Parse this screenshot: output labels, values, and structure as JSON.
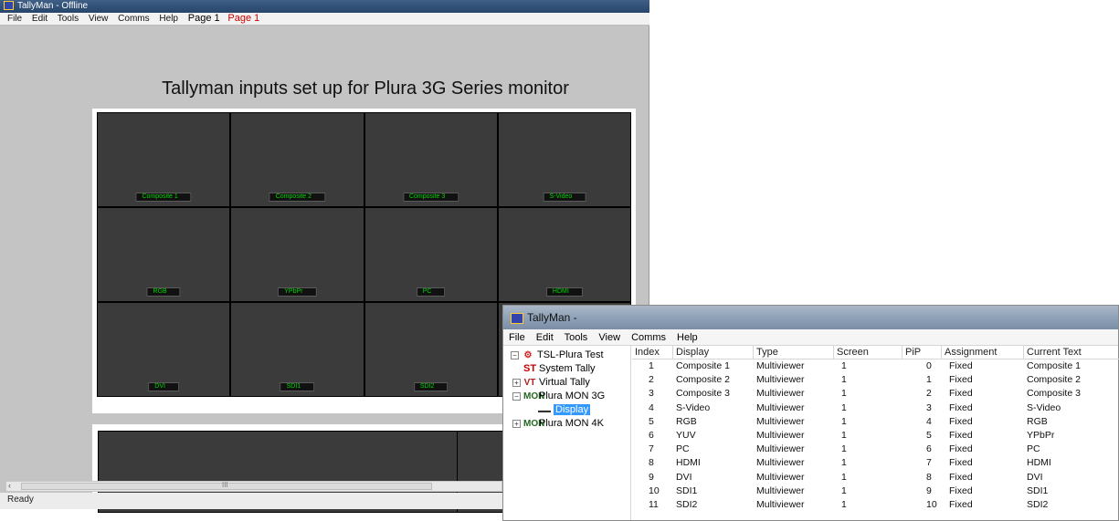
{
  "back_window": {
    "title": "TallyMan - Offline",
    "menu": [
      "File",
      "Edit",
      "Tools",
      "View",
      "Comms",
      "Help"
    ],
    "page_tabs": [
      "Page 1",
      "Page 1"
    ],
    "heading": "Tallyman inputs set up for Plura 3G Series monitor",
    "cells": [
      "Composite 1",
      "Composite 2",
      "Composite 3",
      "S-Video",
      "RGB",
      "YPbPr",
      "PC",
      "HDMI",
      "DVI",
      "SDI1",
      "SDI2",
      ""
    ],
    "status": "Ready",
    "scroll_grip": "III"
  },
  "front_window": {
    "title": "TallyMan -",
    "menu": [
      "File",
      "Edit",
      "Tools",
      "View",
      "Comms",
      "Help"
    ],
    "tree": [
      {
        "label": "TSL-Plura Test",
        "expander": "−",
        "icon": "TSL",
        "indent": 0
      },
      {
        "label": "System Tally",
        "expander": "",
        "icon": "ST",
        "indent": 1
      },
      {
        "label": "Virtual Tally",
        "expander": "+",
        "icon": "VT",
        "indent": 1
      },
      {
        "label": "Plura MON 3G",
        "expander": "−",
        "icon": "MON",
        "indent": 1
      },
      {
        "label": "Display",
        "expander": "",
        "icon": "▬▬",
        "indent": 2,
        "selected": true
      },
      {
        "label": "Plura MON 4K",
        "expander": "+",
        "icon": "MON",
        "indent": 1
      }
    ],
    "columns": [
      "Index",
      "Display",
      "Type",
      "Screen",
      "PiP",
      "Assignment",
      "Current Text"
    ],
    "rows": [
      [
        "1",
        "Composite 1",
        "Multiviewer",
        "1",
        "0",
        "Fixed",
        "Composite 1"
      ],
      [
        "2",
        "Composite 2",
        "Multiviewer",
        "1",
        "1",
        "Fixed",
        "Composite 2"
      ],
      [
        "3",
        "Composite 3",
        "Multiviewer",
        "1",
        "2",
        "Fixed",
        "Composite 3"
      ],
      [
        "4",
        "S-Video",
        "Multiviewer",
        "1",
        "3",
        "Fixed",
        "S-Video"
      ],
      [
        "5",
        "RGB",
        "Multiviewer",
        "1",
        "4",
        "Fixed",
        "RGB"
      ],
      [
        "6",
        "YUV",
        "Multiviewer",
        "1",
        "5",
        "Fixed",
        "YPbPr"
      ],
      [
        "7",
        "PC",
        "Multiviewer",
        "1",
        "6",
        "Fixed",
        "PC"
      ],
      [
        "8",
        "HDMI",
        "Multiviewer",
        "1",
        "7",
        "Fixed",
        "HDMI"
      ],
      [
        "9",
        "DVI",
        "Multiviewer",
        "1",
        "8",
        "Fixed",
        "DVI"
      ],
      [
        "10",
        "SDI1",
        "Multiviewer",
        "1",
        "9",
        "Fixed",
        "SDI1"
      ],
      [
        "11",
        "SDI2",
        "Multiviewer",
        "1",
        "10",
        "Fixed",
        "SDI2"
      ]
    ]
  }
}
